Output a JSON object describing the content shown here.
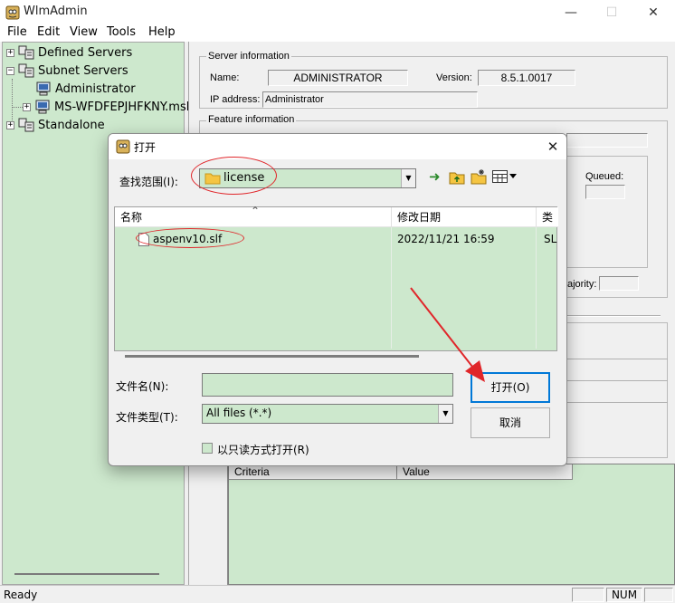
{
  "app": {
    "title": "WlmAdmin",
    "window_controls": {
      "minimize": "—",
      "maximize": "☐",
      "close": "✕"
    }
  },
  "menu": [
    "File",
    "Edit",
    "View",
    "Tools",
    "Help"
  ],
  "tree": [
    {
      "label": "Defined Servers",
      "expander": "+",
      "icon": "servers-icon"
    },
    {
      "label": "Subnet Servers",
      "expander": "−",
      "icon": "servers-icon"
    },
    {
      "label": "Administrator",
      "expander": "",
      "icon": "computer-icon"
    },
    {
      "label": "MS-WFDFEPJHFKNY.msh",
      "expander": "+",
      "icon": "computer-icon"
    },
    {
      "label": "Standalone",
      "expander": "+",
      "icon": "servers-icon"
    }
  ],
  "server_info": {
    "group_title": "Server information",
    "name_label": "Name:",
    "name_value": "ADMINISTRATOR",
    "version_label": "Version:",
    "version_value": "8.5.1.0017",
    "ip_label": "IP address:",
    "ip_value": "Administrator"
  },
  "feature_info": {
    "group_title": "Feature information",
    "queued_label": "Queued:",
    "majority_label": "ajority:"
  },
  "grid": {
    "headers": [
      "Criteria",
      "Value"
    ]
  },
  "status": {
    "text": "Ready",
    "num": "NUM"
  },
  "dialog": {
    "title": "打开",
    "close": "✕",
    "lookin_label": "查找范围(I):",
    "lookin_value": "license",
    "toolbar_icons": [
      "back-arrow-icon",
      "up-folder-icon",
      "new-folder-icon",
      "view-menu-icon"
    ],
    "columns": {
      "name": "名称",
      "modified": "修改日期",
      "type": "类"
    },
    "files": [
      {
        "name": "aspenv10.slf",
        "modified": "2022/11/21 16:59",
        "type": "SL"
      }
    ],
    "filename_label": "文件名(N):",
    "filename_value": "",
    "filetype_label": "文件类型(T):",
    "filetype_value": "All files (*.*)",
    "readonly_label": "以只读方式打开(R)",
    "open_button": "打开(O)",
    "cancel_button": "取消"
  },
  "colors": {
    "accent_green": "#cde8cd",
    "annotation_red": "#e0262a",
    "focus_blue": "#0078d7"
  }
}
